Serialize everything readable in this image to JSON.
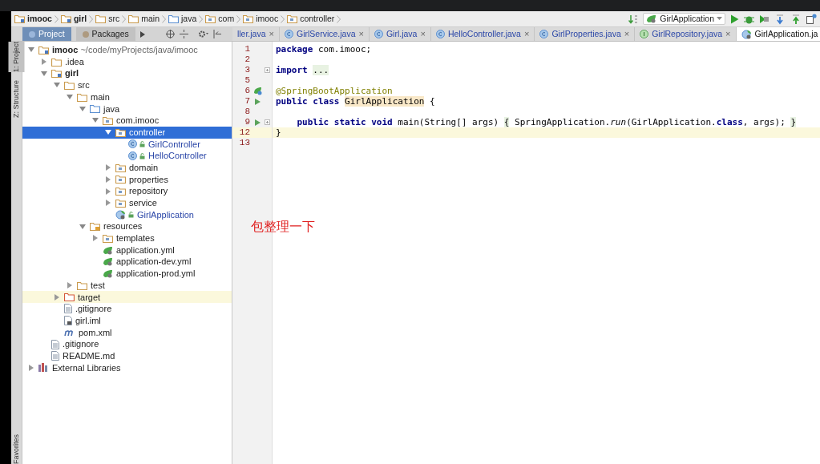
{
  "breadcrumb": [
    {
      "label": "imooc",
      "kind": "module"
    },
    {
      "label": "girl",
      "kind": "module"
    },
    {
      "label": "src",
      "kind": "folder"
    },
    {
      "label": "main",
      "kind": "folder"
    },
    {
      "label": "java",
      "kind": "source"
    },
    {
      "label": "com",
      "kind": "package"
    },
    {
      "label": "imooc",
      "kind": "package"
    },
    {
      "label": "controller",
      "kind": "package"
    }
  ],
  "run_config": {
    "label": "GirlApplication"
  },
  "tool_tabs": [
    {
      "label": "Project",
      "selected": true
    },
    {
      "label": "Packages",
      "selected": false
    }
  ],
  "editor_tabs": [
    {
      "label": "ller.java",
      "kind": "cut",
      "selected": false,
      "close": "×"
    },
    {
      "label": "GirlService.java",
      "kind": "class",
      "selected": false,
      "close": "×"
    },
    {
      "label": "Girl.java",
      "kind": "class",
      "selected": false,
      "close": "×"
    },
    {
      "label": "HelloController.java",
      "kind": "class",
      "selected": false,
      "close": "×"
    },
    {
      "label": "GirlProperties.java",
      "kind": "class",
      "selected": false,
      "close": "×"
    },
    {
      "label": "GirlRepository.java",
      "kind": "interface",
      "selected": false,
      "close": "×"
    },
    {
      "label": "GirlApplication.ja",
      "kind": "spring",
      "selected": true
    }
  ],
  "side_strip": {
    "top": [
      "1: Project",
      "Z: Structure"
    ],
    "bottom": "Favorites"
  },
  "tree": [
    {
      "label": "imooc",
      "path": "~/code/myProjects/java/imooc",
      "kind": "module",
      "expanded": true,
      "selected": false,
      "highlighted": false,
      "children": [
        {
          "label": ".idea",
          "kind": "folder",
          "expanded": false,
          "selected": false,
          "highlighted": false
        },
        {
          "label": "girl",
          "kind": "module",
          "expanded": true,
          "selected": false,
          "highlighted": false,
          "children": [
            {
              "label": "src",
              "kind": "folder",
              "expanded": true,
              "selected": false,
              "highlighted": false,
              "children": [
                {
                  "label": "main",
                  "kind": "folder",
                  "expanded": true,
                  "selected": false,
                  "highlighted": false,
                  "children": [
                    {
                      "label": "java",
                      "kind": "source",
                      "expanded": true,
                      "selected": false,
                      "highlighted": false,
                      "children": [
                        {
                          "label": "com.imooc",
                          "kind": "package",
                          "expanded": true,
                          "selected": false,
                          "highlighted": false,
                          "children": [
                            {
                              "label": "controller",
                              "kind": "package",
                              "expanded": true,
                              "selected": true,
                              "highlighted": false,
                              "children": [
                                {
                                  "label": "GirlController",
                                  "kind": "class",
                                  "selected": false,
                                  "highlighted": false
                                },
                                {
                                  "label": "HelloController",
                                  "kind": "class",
                                  "selected": false,
                                  "highlighted": false
                                }
                              ]
                            },
                            {
                              "label": "domain",
                              "kind": "package",
                              "expanded": false,
                              "selected": false,
                              "highlighted": false
                            },
                            {
                              "label": "properties",
                              "kind": "package",
                              "expanded": false,
                              "selected": false,
                              "highlighted": false
                            },
                            {
                              "label": "repository",
                              "kind": "package",
                              "expanded": false,
                              "selected": false,
                              "highlighted": false
                            },
                            {
                              "label": "service",
                              "kind": "package",
                              "expanded": false,
                              "selected": false,
                              "highlighted": false
                            },
                            {
                              "label": "GirlApplication",
                              "kind": "spring-class",
                              "selected": false,
                              "highlighted": false
                            }
                          ]
                        }
                      ]
                    },
                    {
                      "label": "resources",
                      "kind": "resources",
                      "expanded": true,
                      "selected": false,
                      "highlighted": false,
                      "children": [
                        {
                          "label": "templates",
                          "kind": "package",
                          "expanded": false,
                          "selected": false,
                          "highlighted": false
                        },
                        {
                          "label": "application.yml",
                          "kind": "yml",
                          "selected": false,
                          "highlighted": false
                        },
                        {
                          "label": "application-dev.yml",
                          "kind": "yml",
                          "selected": false,
                          "highlighted": false
                        },
                        {
                          "label": "application-prod.yml",
                          "kind": "yml",
                          "selected": false,
                          "highlighted": false
                        }
                      ]
                    }
                  ]
                },
                {
                  "label": "test",
                  "kind": "folder",
                  "expanded": false,
                  "selected": false,
                  "highlighted": false
                }
              ]
            },
            {
              "label": "target",
              "kind": "excluded",
              "expanded": false,
              "selected": false,
              "highlighted": true
            },
            {
              "label": ".gitignore",
              "kind": "file",
              "selected": false,
              "highlighted": false
            },
            {
              "label": "girl.iml",
              "kind": "iml",
              "selected": false,
              "highlighted": false
            },
            {
              "label": "pom.xml",
              "kind": "maven",
              "selected": false,
              "highlighted": false
            }
          ]
        },
        {
          "label": ".gitignore",
          "kind": "file",
          "selected": false,
          "highlighted": false
        },
        {
          "label": "README.md",
          "kind": "file",
          "selected": false,
          "highlighted": false
        }
      ]
    },
    {
      "label": "External Libraries",
      "kind": "library",
      "expanded": false,
      "selected": false,
      "highlighted": false
    }
  ],
  "code": [
    {
      "number": "1",
      "kind": "plain",
      "current": false,
      "fold": false,
      "tokens": [
        {
          "text": "package",
          "kind": "keyword"
        },
        {
          "text": " com.imooc;",
          "kind": "plain"
        }
      ]
    },
    {
      "number": "2",
      "kind": "plain",
      "current": false,
      "fold": false
    },
    {
      "number": "3",
      "kind": "plain",
      "current": false,
      "fold": true,
      "tokens": [
        {
          "text": "import ",
          "kind": "keyword"
        },
        {
          "text": "...",
          "kind": "folded"
        }
      ]
    },
    {
      "number": "5",
      "kind": "plain",
      "current": false,
      "fold": false
    },
    {
      "number": "6",
      "kind": "bean",
      "current": false,
      "fold": false,
      "tokens": [
        {
          "text": "@SpringBootApplication",
          "kind": "annotation"
        }
      ]
    },
    {
      "number": "7",
      "kind": "run",
      "current": false,
      "fold": false,
      "tokens": [
        {
          "text": "public class ",
          "kind": "keyword"
        },
        {
          "text": "GirlApplication",
          "kind": "highlight"
        },
        {
          "text": " {",
          "kind": "plain"
        }
      ]
    },
    {
      "number": "8",
      "kind": "plain",
      "current": false,
      "fold": false
    },
    {
      "number": "9",
      "kind": "run",
      "current": false,
      "fold": true,
      "tokens": [
        {
          "text": "    public static void",
          "kind": "keyword"
        },
        {
          "text": " main(String[] args) ",
          "kind": "plain"
        },
        {
          "text": "{",
          "kind": "folded"
        },
        {
          "text": " SpringApplication.",
          "kind": "plain"
        },
        {
          "text": "run",
          "kind": "italic"
        },
        {
          "text": "(GirlApplication.",
          "kind": "plain"
        },
        {
          "text": "class",
          "kind": "keyword"
        },
        {
          "text": ", args); ",
          "kind": "plain"
        },
        {
          "text": "}",
          "kind": "folded"
        }
      ]
    },
    {
      "number": "12",
      "kind": "plain",
      "current": true,
      "fold": false,
      "tokens": [
        {
          "text": "}",
          "kind": "plain"
        }
      ]
    },
    {
      "number": "13",
      "kind": "plain",
      "current": false,
      "fold": false
    }
  ],
  "caption": "包整理一下"
}
